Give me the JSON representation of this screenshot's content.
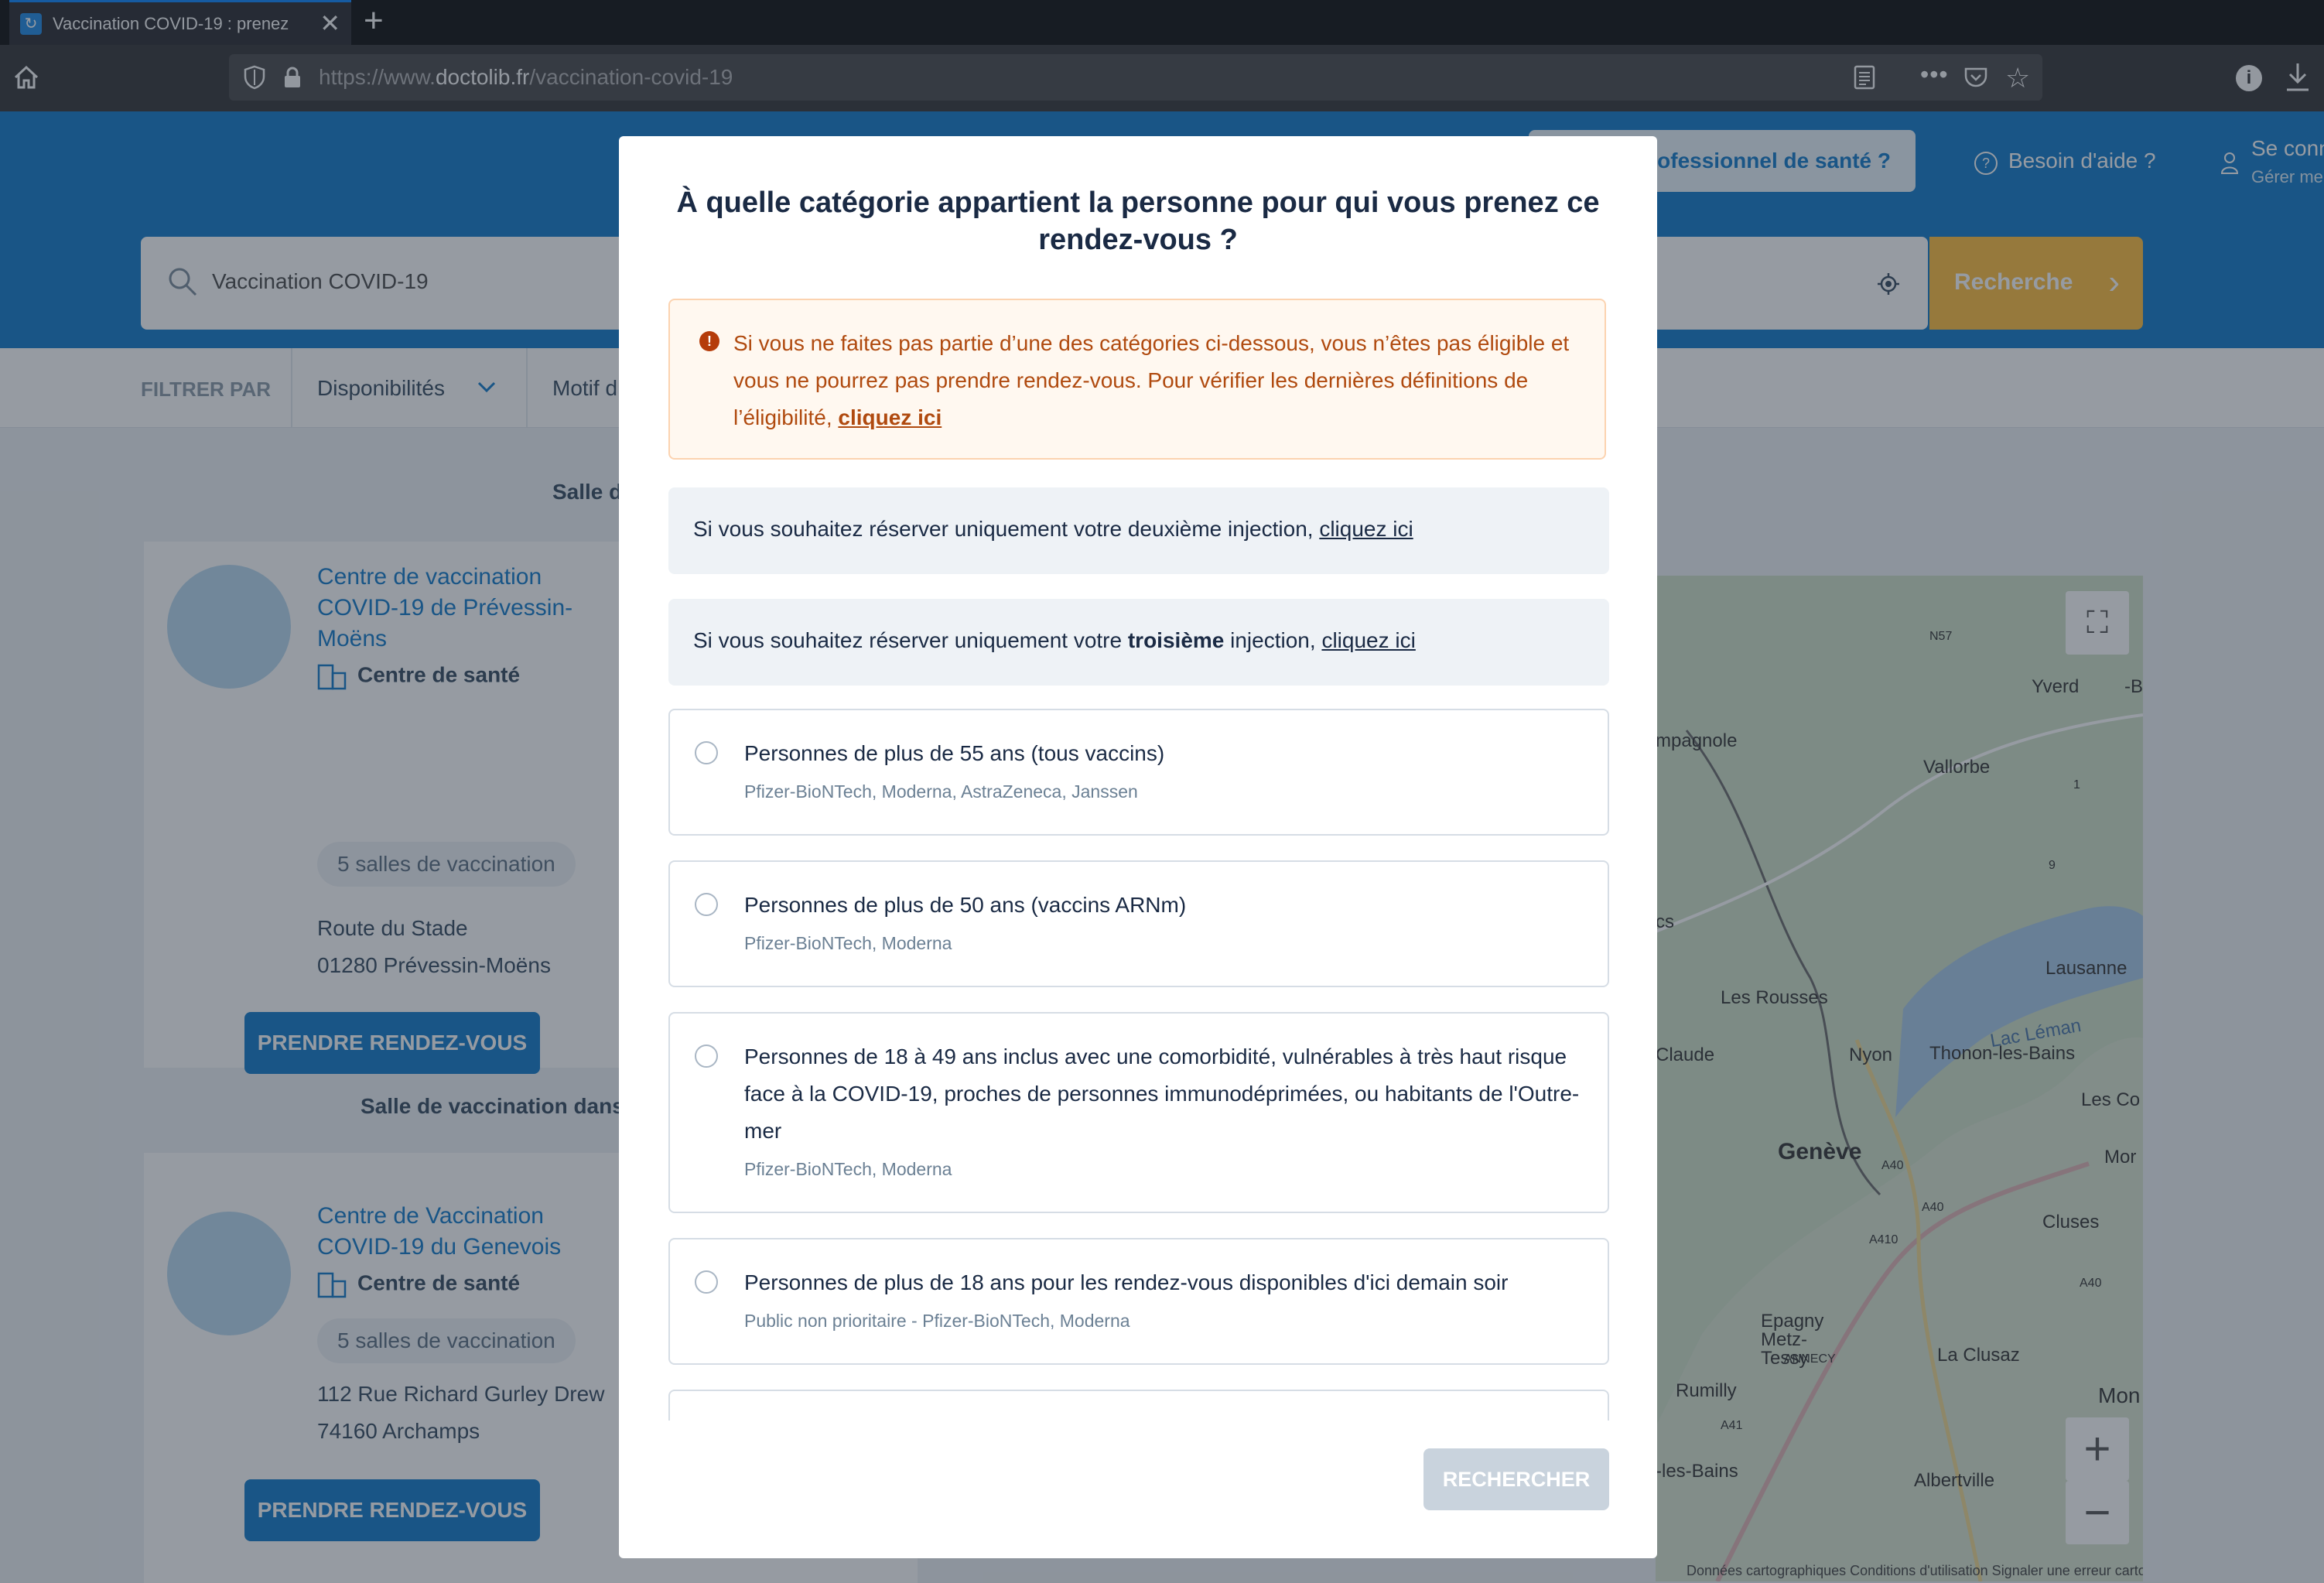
{
  "browser": {
    "tab_title": "Vaccination COVID-19 : prenez",
    "url_prefix": "https://www.",
    "url_domain": "doctolib.fr",
    "url_path": "/vaccination-covid-19"
  },
  "header": {
    "pro_button": "professionnel de santé ?",
    "help": "Besoin d'aide ?",
    "connect": "Se conn",
    "manage": "Gérer me"
  },
  "search": {
    "value": "Vaccination COVID-19",
    "button": "Recherche"
  },
  "filters": {
    "label": "FILTRER PAR",
    "availability": "Disponibilités",
    "motive": "Motif d"
  },
  "results": {
    "section1": "Salle d",
    "section2": "Salle de vaccination dans l",
    "cards": [
      {
        "name": "Centre de vaccination COVID-19 de Prévessin-Moëns",
        "type": "Centre de santé",
        "rooms": "5 salles de vaccination",
        "address1": "Route du Stade",
        "address2": "01280 Prévessin-Moëns",
        "button": "PRENDRE RENDEZ-VOUS"
      },
      {
        "name": "Centre de Vaccination COVID-19 du Genevois",
        "type": "Centre de santé",
        "rooms": "5 salles de vaccination",
        "address1": "112 Rue Richard Gurley Drew",
        "address2": "74160 Archamps",
        "button": "PRENDRE RENDEZ-VOUS"
      }
    ]
  },
  "map": {
    "labels": [
      "N57",
      "Yverd",
      "-B",
      "mpagnole",
      "Vallorbe",
      "1",
      "9",
      "cs",
      "Lausanne",
      "Les Rousses",
      "Lac Léman",
      "Claude",
      "Nyon",
      "Thonon-les-Bains",
      "Les Co",
      "Genève",
      "Mor",
      "A40",
      "A40",
      "Cluses",
      "A410",
      "A40",
      "Epagny Metz-Tessy",
      "ANNECY",
      "La Clusaz",
      "Rumilly",
      "A41",
      "Mon",
      "Albertville",
      "-les-Bains"
    ],
    "footer": "Données cartographiques    Conditions d'utilisation    Signaler une erreur cartographique",
    "zoom_in": "+",
    "zoom_out": "−"
  },
  "modal": {
    "title": "À quelle catégorie appartient la personne pour qui vous prenez ce rendez-vous ?",
    "warning_text": "Si vous ne faites pas partie d’une des catégories ci-dessous, vous n’êtes pas éligible et vous ne pourrez pas prendre rendez-vous. Pour vérifier les dernières définitions de l’éligibilité, ",
    "warning_link": "cliquez ici",
    "second_text": "Si vous souhaitez réserver uniquement votre deuxième injection, ",
    "second_link": "cliquez ici",
    "third_pre": "Si vous souhaitez réserver uniquement votre ",
    "third_bold": "troisième",
    "third_post": " injection, ",
    "third_link": "cliquez ici",
    "options": [
      {
        "label": "Personnes de plus de 55 ans (tous vaccins)",
        "sub": "Pfizer-BioNTech, Moderna, AstraZeneca, Janssen"
      },
      {
        "label": "Personnes de plus de 50 ans (vaccins ARNm)",
        "sub": "Pfizer-BioNTech, Moderna"
      },
      {
        "label": "Personnes de 18 à 49 ans inclus avec une comorbidité, vulnérables à très haut risque face à la COVID-19, proches de personnes immunodéprimées, ou habitants de l'Outre-mer",
        "sub": "Pfizer-BioNTech, Moderna"
      },
      {
        "label": "Personnes de plus de 18 ans pour les rendez-vous disponibles d'ici demain soir",
        "sub": "Public non prioritaire - Pfizer-BioNTech, Moderna"
      }
    ],
    "submit": "RECHERCHER"
  }
}
